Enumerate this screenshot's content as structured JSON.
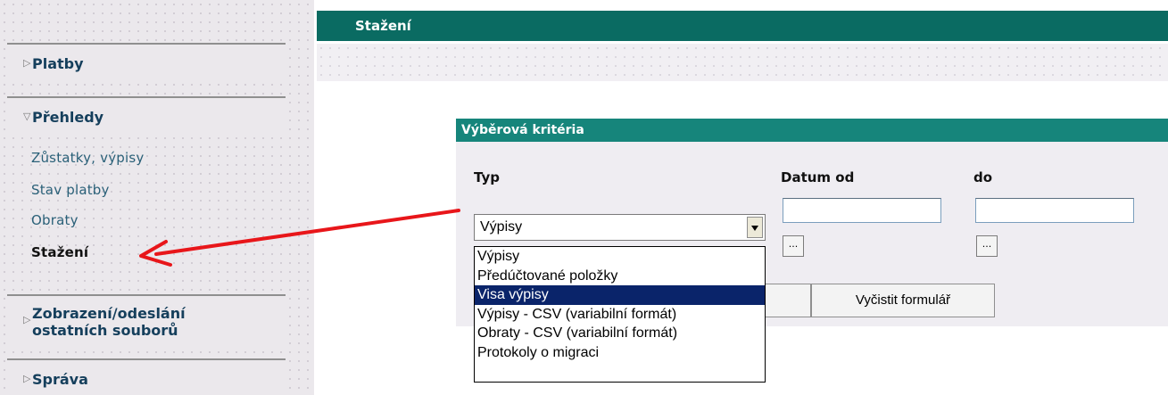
{
  "sidebar": {
    "sections": [
      {
        "label": "Platby"
      },
      {
        "label": "Přehledy"
      },
      {
        "label_line1": "Zobrazení/odeslání",
        "label_line2": "ostatních souborů"
      },
      {
        "label": "Správa"
      }
    ],
    "items": [
      {
        "label": "Zůstatky, výpisy"
      },
      {
        "label": "Stav platby"
      },
      {
        "label": "Obraty"
      },
      {
        "label": "Stažení"
      }
    ]
  },
  "header": {
    "title": "Stažení"
  },
  "criteria": {
    "title": "Výběrová kritéria",
    "type_label": "Typ",
    "date_from_label": "Datum od",
    "date_to_label": "do",
    "date_from_value": "",
    "date_to_value": "",
    "calendar_btn": "...",
    "type_value": "Výpisy",
    "clear_btn": "Vyčistit formulář"
  },
  "dropdown": {
    "options": [
      "Výpisy",
      "Předúčtované položky",
      "Visa výpisy",
      "Výpisy - CSV (variabilní formát)",
      "Obraty - CSV (variabilní formát)",
      "Protokoly o migraci"
    ],
    "highlighted_index": 2
  },
  "colors": {
    "header_bg": "#0a6b62",
    "criteria_header_bg": "#16857b",
    "highlight_bg": "#0a246a",
    "annotation": "#e8161a"
  }
}
